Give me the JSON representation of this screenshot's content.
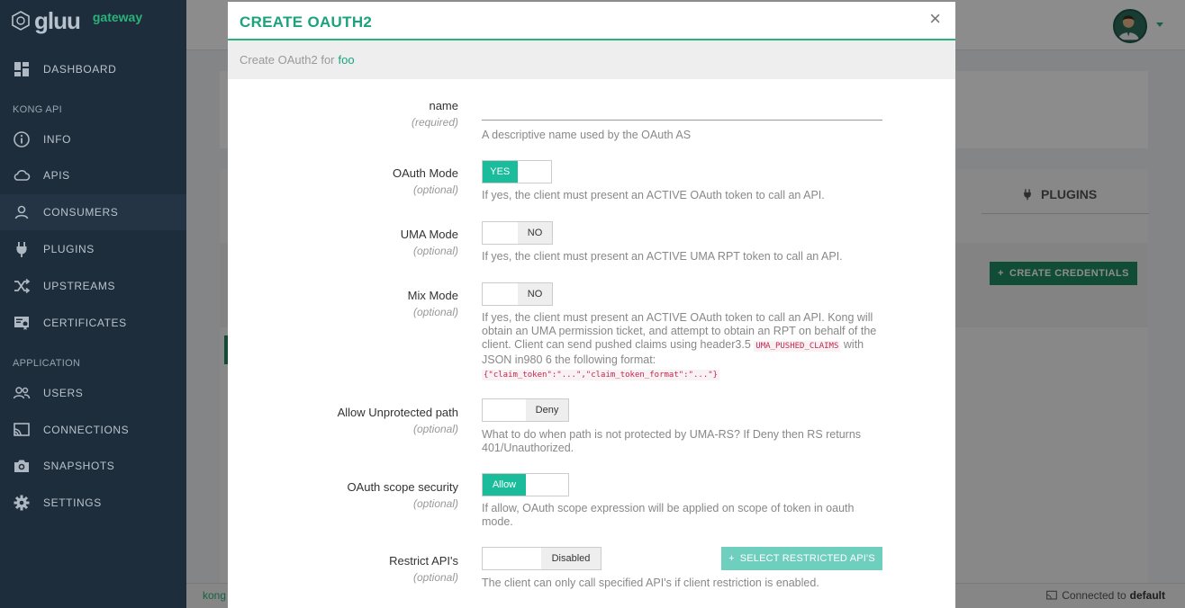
{
  "brand": {
    "name": "gluu",
    "sub": "gateway"
  },
  "sidebar": {
    "items": [
      {
        "label": "DASHBOARD",
        "icon": "dashboard-icon"
      },
      {
        "label": "INFO",
        "icon": "info-icon"
      },
      {
        "label": "APIS",
        "icon": "cloud-icon"
      },
      {
        "label": "CONSUMERS",
        "icon": "user-icon"
      },
      {
        "label": "PLUGINS",
        "icon": "plug-icon"
      },
      {
        "label": "UPSTREAMS",
        "icon": "shuffle-icon"
      },
      {
        "label": "CERTIFICATES",
        "icon": "certificate-icon"
      },
      {
        "label": "USERS",
        "icon": "users-icon"
      },
      {
        "label": "CONNECTIONS",
        "icon": "cast-icon"
      },
      {
        "label": "SNAPSHOTS",
        "icon": "camera-icon"
      },
      {
        "label": "SETTINGS",
        "icon": "gear-icon"
      }
    ],
    "sections": {
      "kong": "KONG API",
      "application": "APPLICATION"
    }
  },
  "background": {
    "plugins_tab": "PLUGINS",
    "create_credentials": "CREATE CREDENTIALS",
    "footer_left": "kong",
    "footer_connected": "Connected to",
    "footer_target": "default"
  },
  "modal": {
    "title": "CREATE OAUTH2",
    "close": "×",
    "subtitle_prefix": "Create OAuth2 for",
    "subtitle_consumer": "foo",
    "fields": {
      "name": {
        "label": "name",
        "sub": "(required)",
        "value": "",
        "help": "A descriptive name used by the OAuth AS"
      },
      "oauth_mode": {
        "label": "OAuth Mode",
        "sub": "(optional)",
        "state": "YES",
        "help": "If yes, the client must present an ACTIVE OAuth token to call an API."
      },
      "uma_mode": {
        "label": "UMA Mode",
        "sub": "(optional)",
        "state": "NO",
        "help": "If yes, the client must present an ACTIVE UMA RPT token to call an API."
      },
      "mix_mode": {
        "label": "Mix Mode",
        "sub": "(optional)",
        "state": "NO",
        "help_1": "If yes, the client must present an ACTIVE OAuth token to call an API. Kong will obtain an UMA permission ticket, and attempt to obtain an RPT on behalf of the client. Client can send pushed claims using header3.5",
        "help_code_1": "UMA_PUSHED_CLAIMS",
        "help_2": "with JSON in980 6 the following format:",
        "help_code_2": "{\"claim_token\":\"...\",\"claim_token_format\":\"...\"}"
      },
      "unprotected": {
        "label": "Allow Unprotected path",
        "sub": "(optional)",
        "state": "Deny",
        "help": "What to do when path is not protected by UMA-RS? If Deny then RS returns 401/Unauthorized."
      },
      "scope_security": {
        "label": "OAuth scope security",
        "sub": "(optional)",
        "state": "Allow",
        "help": "If allow, OAuth scope expression will be applied on scope of token in oauth mode."
      },
      "restrict_apis": {
        "label": "Restrict API's",
        "sub": "(optional)",
        "state": "Disabled",
        "button": "SELECT RESTRICTED API'S",
        "help": "The client can only call specified API's if client restriction is enabled."
      }
    }
  },
  "colors": {
    "accent": "#1abc9c",
    "sidebar": "#1e2d3b",
    "title": "#1aa37d"
  }
}
